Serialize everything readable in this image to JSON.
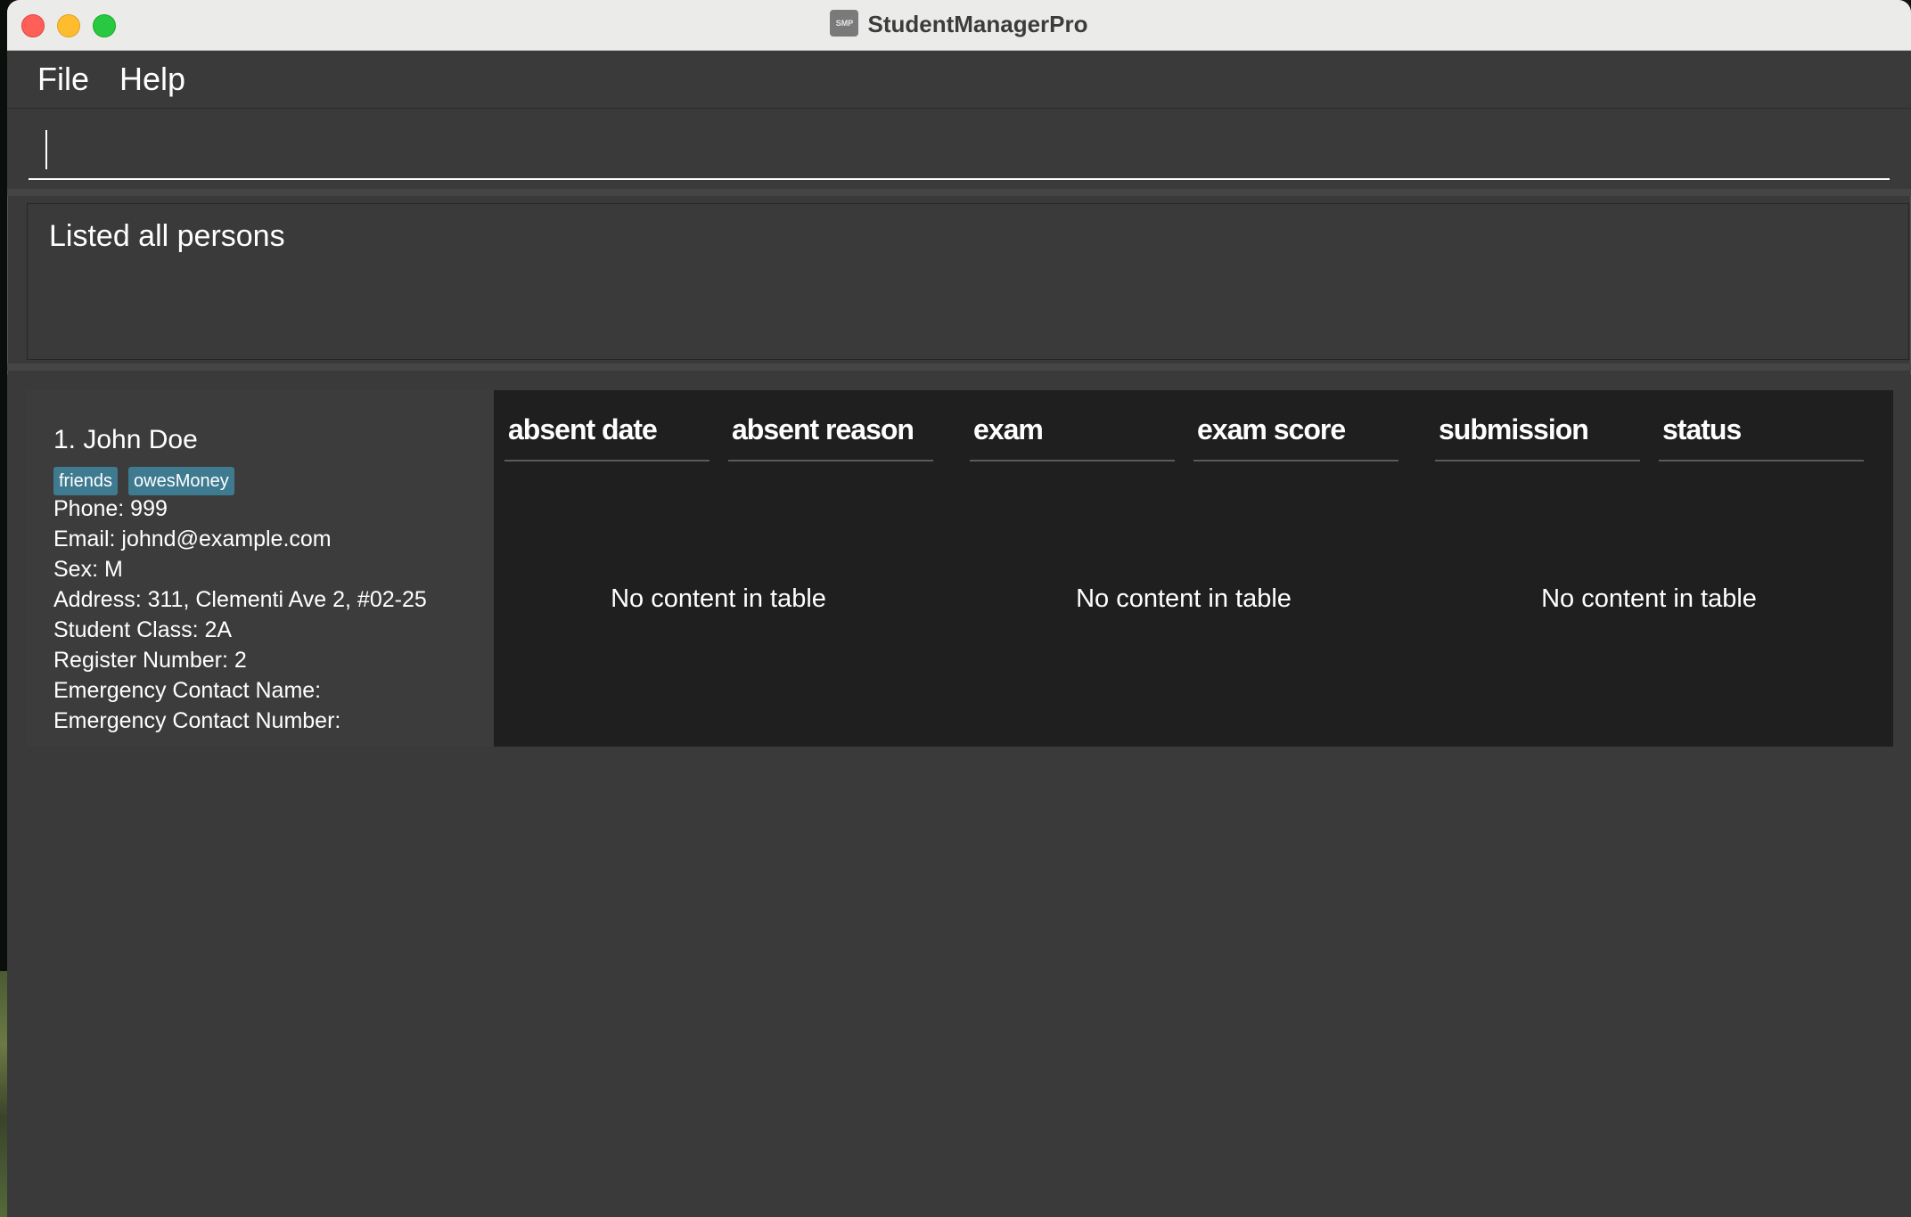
{
  "window": {
    "title": "StudentManagerPro",
    "app_icon_label": "SMP"
  },
  "menubar": {
    "file_label": "File",
    "help_label": "Help"
  },
  "command": {
    "value": "",
    "placeholder": ""
  },
  "result": {
    "message": "Listed all persons"
  },
  "persons": [
    {
      "index_name": "1. John Doe",
      "tags": [
        "friends",
        "owesMoney"
      ],
      "phone": "Phone: 999",
      "email": "Email: johnd@example.com",
      "sex": "Sex: M",
      "address": "Address: 311, Clementi Ave 2, #02-25",
      "student_class": "Student Class: 2A",
      "register_number": "Register Number: 2",
      "emergency_contact_name": "Emergency Contact Name:",
      "emergency_contact_number": "Emergency Contact Number:"
    }
  ],
  "tables": {
    "attendance": {
      "columns": [
        "absent date",
        "absent reason"
      ],
      "placeholder": "No content in table"
    },
    "exams": {
      "columns": [
        "exam",
        "exam score"
      ],
      "placeholder": "No content in table"
    },
    "submissions": {
      "columns": [
        "submission",
        "status"
      ],
      "placeholder": "No content in table"
    }
  },
  "colors": {
    "tag_background": "#3e7b91",
    "window_background": "#3a3a3a",
    "table_background": "#1f1f1f",
    "close_button": "#fe5f57",
    "minimize_button": "#febc2e",
    "maximize_button": "#28c840"
  }
}
